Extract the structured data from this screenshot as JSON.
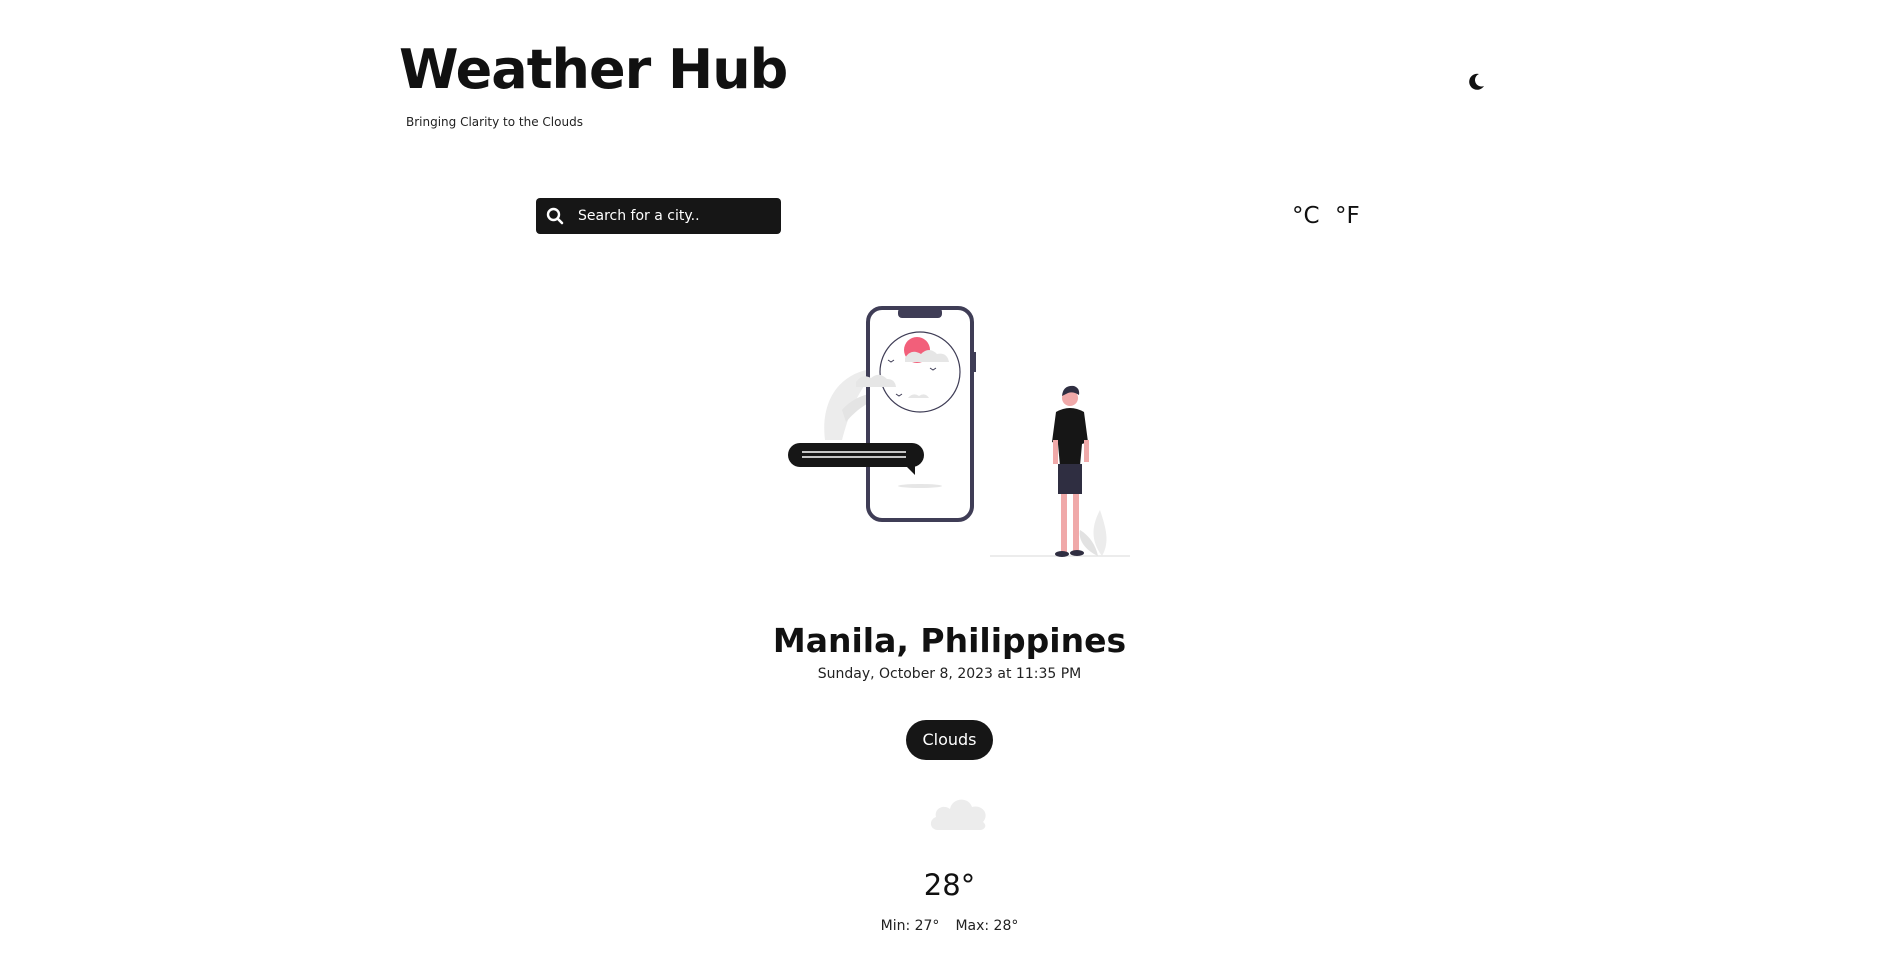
{
  "header": {
    "title": "Weather Hub",
    "tagline": "Bringing Clarity to the Clouds",
    "theme_icon": "moon-icon"
  },
  "search": {
    "placeholder": "Search for a city..",
    "icon": "search-icon"
  },
  "units": {
    "celsius": "°C",
    "fahrenheit": "°F"
  },
  "weather": {
    "location": "Manila, Philippines",
    "datetime": "Sunday, October 8, 2023 at 11:35 PM",
    "condition": "Clouds",
    "condition_icon": "cloud-icon",
    "temperature": "28°",
    "min": "Min: 27°",
    "max": "Max: 28°"
  },
  "colors": {
    "accent_dark": "#161616",
    "sun": "#f25f7a",
    "phone_outline": "#3f3d56"
  }
}
